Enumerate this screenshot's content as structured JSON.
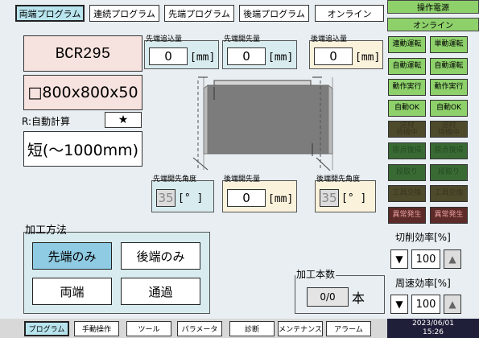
{
  "top_tabs": [
    "両端プログラム",
    "連続プログラム",
    "先端プログラム",
    "後端プログラム",
    "オンライン"
  ],
  "product_code": "BCR295",
  "dimensions": "□800x800x50",
  "auto_calc_label": "R:自動計算",
  "star_symbol": "★",
  "length_class": "短(～1000mm)",
  "fields": {
    "front_feed": {
      "label": "先端追込量",
      "value": "0",
      "unit": "[mm]"
    },
    "front_open": {
      "label": "先端開先量",
      "value": "0",
      "unit": "[mm]"
    },
    "rear_feed": {
      "label": "後端追込量",
      "value": "0",
      "unit": "[mm]"
    },
    "front_angle": {
      "label": "先端開先角度",
      "value": "35",
      "unit": "[° ]"
    },
    "rear_open": {
      "label": "後端開先量",
      "value": "0",
      "unit": "[mm]"
    },
    "rear_angle": {
      "label": "後端開先角度",
      "value": "35",
      "unit": "[° ]"
    }
  },
  "method": {
    "title": "加工方法",
    "buttons": [
      "先端のみ",
      "後端のみ",
      "両端",
      "通過"
    ]
  },
  "count": {
    "title": "加工本数",
    "value": "0/0",
    "unit": "本"
  },
  "sidebar": {
    "header1": "操作電源",
    "header2": "オンライン",
    "buttons": [
      [
        "連動運転",
        "単動運転"
      ],
      [
        "自動運転",
        "自動運転"
      ],
      [
        "動作実行",
        "動作実行"
      ],
      [
        "自動OK",
        "自動OK"
      ],
      [
        "送材\n待機中",
        "送材\n待機中"
      ],
      [
        "原点復帰",
        "原点復帰"
      ],
      [
        "段取り",
        "段取り"
      ],
      [
        "工具交換",
        "工具交換"
      ],
      [
        "異常発生",
        "異常発生"
      ]
    ],
    "cut_rate_label": "切削効率[%]",
    "cut_rate_value": "100",
    "speed_rate_label": "周速効率[%]",
    "speed_rate_value": "100",
    "down_symbol": "▼",
    "up_symbol": "▲"
  },
  "bottom_tabs": [
    "プログラム",
    "手動操作",
    "ツール",
    "パラメータ",
    "診断",
    "メンテナンス",
    "アラーム"
  ],
  "clock": {
    "date": "2023/06/01",
    "time": "15:26"
  },
  "colors": {
    "accent_tab": "#b8e4ee",
    "card_pink": "#f6e2de",
    "panel_green": "#8ed16b"
  }
}
